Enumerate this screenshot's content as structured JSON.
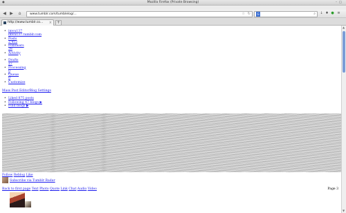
{
  "window": {
    "title": "Mozilla Firefox (Private Browsing)"
  },
  "menu": [
    "File",
    "Edit",
    "View",
    "History",
    "Bookmarks",
    "Tools",
    "Help"
  ],
  "url": {
    "value": "www.tumblr.com/tumblelog/...",
    "star": "☆",
    "reload": "↻"
  },
  "search": {
    "engine": "G",
    "icon": "⌕"
  },
  "tab": {
    "label": "http://www.tumblr.co..."
  },
  "stats": [
    {
      "label": "imvu137",
      "sub": "imvu137.tumblr.com"
    },
    {
      "label": "Posts",
      "sub": "2,452"
    },
    {
      "label": "Followers",
      "sub": "28"
    },
    {
      "label": "Activity",
      "sub": ""
    },
    {
      "label": "Drafts",
      "sub": "27"
    },
    {
      "label": "Processing",
      "sub": "0"
    },
    {
      "label": "Queue",
      "sub": "0"
    },
    {
      "label": "Customize",
      "sub": ""
    }
  ],
  "manage": [
    "Mass Post Editor",
    "Blog Settings"
  ],
  "misc": [
    "Liked 875 posts",
    "Following 47 blogs ▶",
    "Find blogs ▶"
  ],
  "follow": [
    "Follow",
    "Reblog",
    "Like"
  ],
  "subscribe_text": "Subscribe via Tumblr Radar",
  "back_link": "Back to first page",
  "post_types": [
    "Text",
    "Photo",
    "Quote",
    "Link",
    "Chat",
    "Audio",
    "Video"
  ],
  "page_label": "Page 3",
  "icons": {
    "back": "◀",
    "forward": "▶",
    "home": "⌂",
    "scroll_up": "▲",
    "scroll_down": "▼",
    "new_tab": "+"
  }
}
